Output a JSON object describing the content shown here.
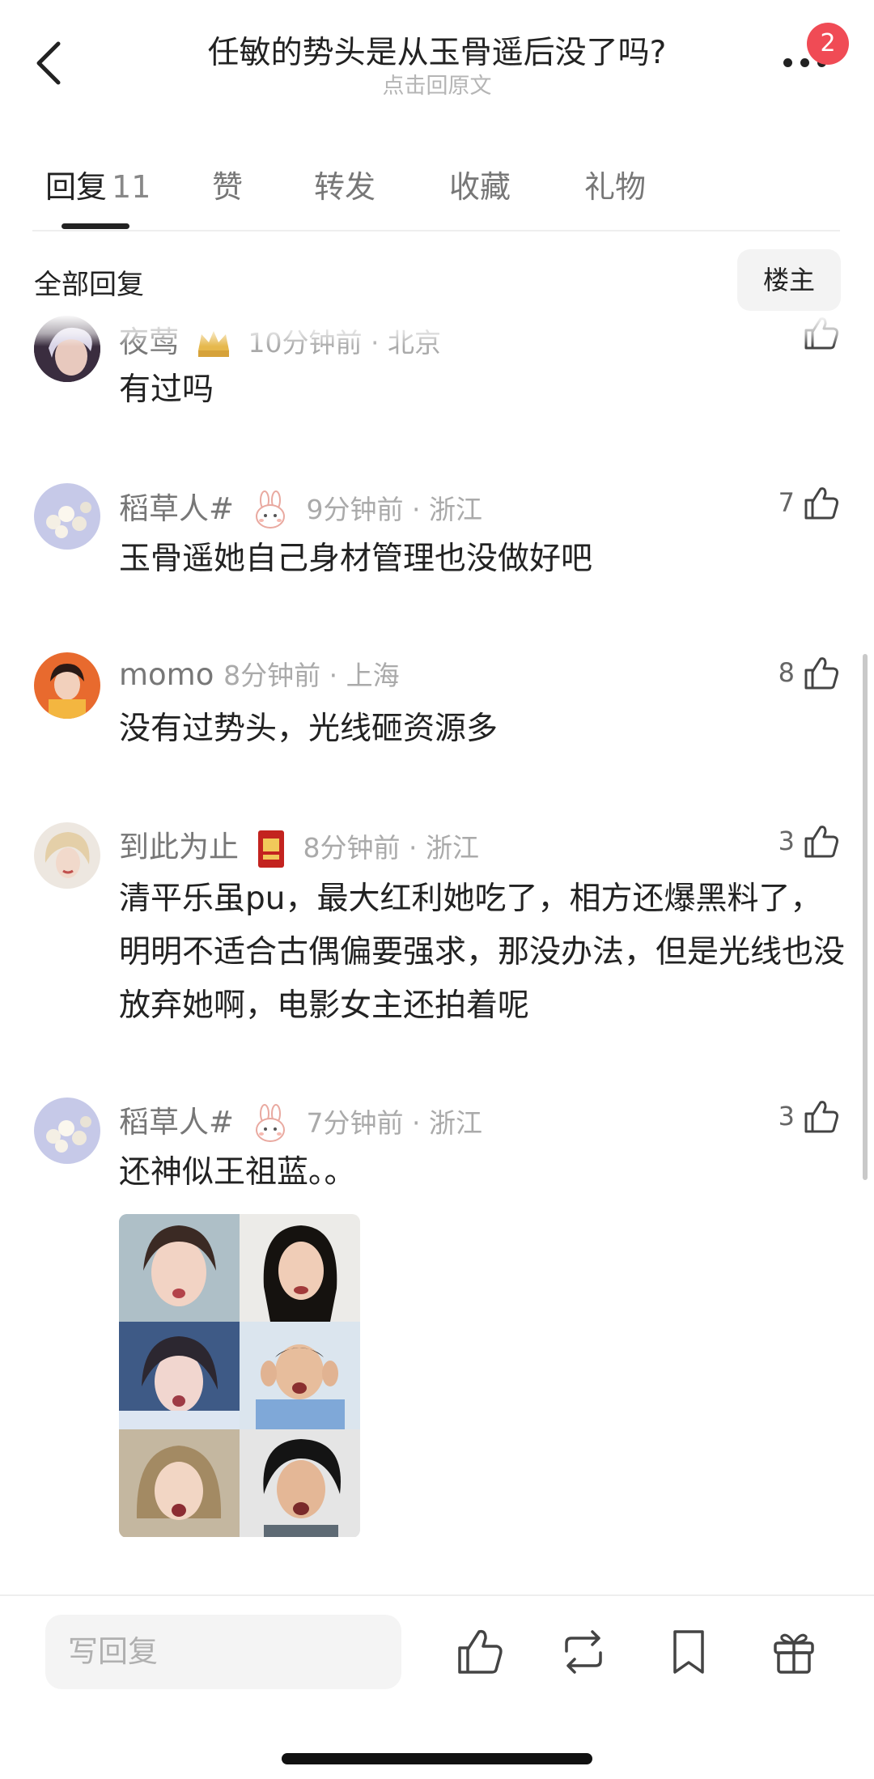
{
  "header": {
    "title": "任敏的势头是从玉骨遥后没了吗?",
    "subtitle": "点击回原文",
    "notification_count": "2"
  },
  "tabs": [
    {
      "label": "回复",
      "count": "11"
    },
    {
      "label": "赞"
    },
    {
      "label": "转发"
    },
    {
      "label": "收藏"
    },
    {
      "label": "礼物"
    }
  ],
  "filter": {
    "all_label": "全部回复",
    "op_label": "楼主"
  },
  "comments": [
    {
      "username": "夜莺",
      "time": "10分钟前 · 北京",
      "likes": "",
      "text": "有过吗"
    },
    {
      "username": "稻草人#",
      "time": "9分钟前 · 浙江",
      "likes": "7",
      "text": "玉骨遥她自己身材管理也没做好吧"
    },
    {
      "username": "momo",
      "time": "8分钟前 · 上海",
      "likes": "8",
      "text": "没有过势头，光线砸资源多"
    },
    {
      "username": "到此为止",
      "time": "8分钟前 · 浙江",
      "likes": "3",
      "text": "清平乐虽pu，最大红利她吃了，相方还爆黑料了，明明不适合古偶偏要强求，那没办法，但是光线也没放弃她啊，电影女主还拍着呢"
    },
    {
      "username": "稻草人#",
      "time": "7分钟前 · 浙江",
      "likes": "3",
      "text": "还神似王祖蓝。。"
    }
  ],
  "composer": {
    "placeholder": "写回复"
  },
  "icons": {
    "back": "chevron-left-icon",
    "more": "more-dots-icon",
    "like": "thumbs-up-icon",
    "repost": "repost-icon",
    "bookmark": "bookmark-icon",
    "gift": "gift-icon"
  },
  "colors": {
    "badge": "#f04b55",
    "text_primary": "#222222",
    "text_secondary": "#777777",
    "meta": "#aaaaaa"
  }
}
